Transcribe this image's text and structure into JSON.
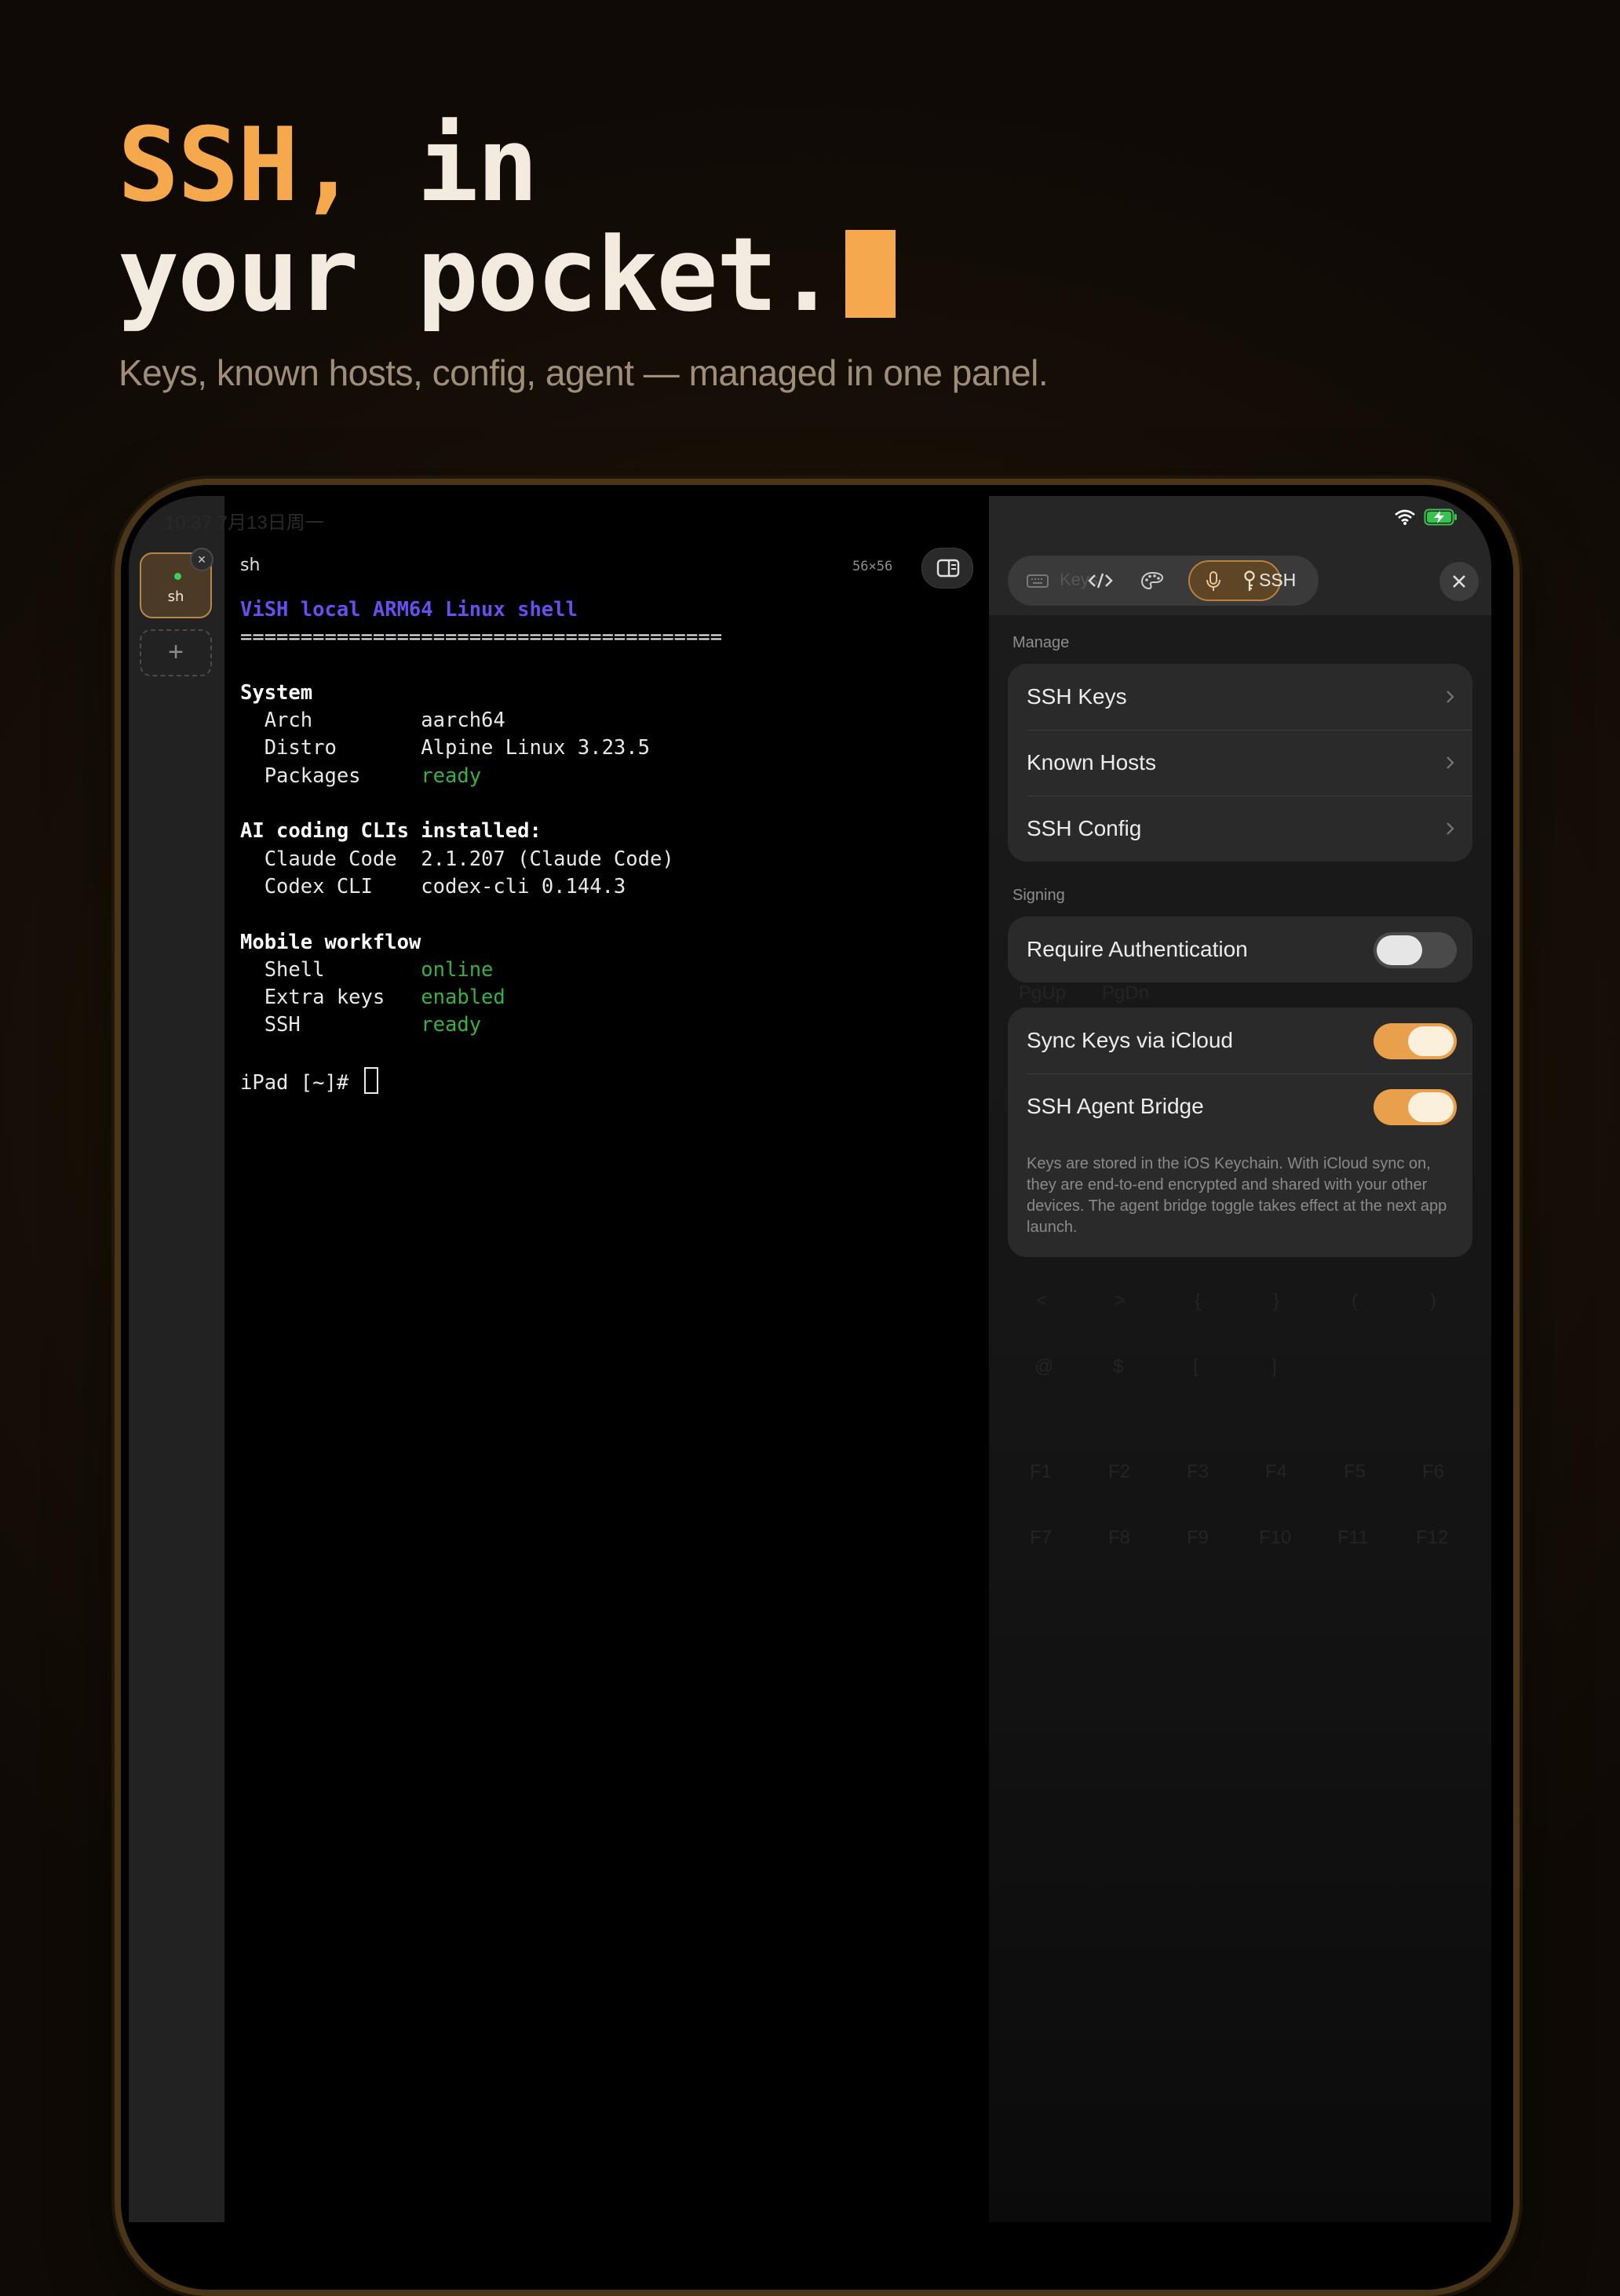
{
  "hero": {
    "line1_accent": "SSH,",
    "line1_rest": " in",
    "line2": "your pocket.",
    "subtitle": "Keys, known hosts, config, agent — managed in one panel."
  },
  "status_bar": {
    "time": "10:37  7月13日周一"
  },
  "sidebar": {
    "tab_label": "sh",
    "tab_close": "×",
    "add": "+"
  },
  "terminal": {
    "title": "sh",
    "size": "56×56",
    "heading": "ViSH local ARM64 Linux shell",
    "rule": "========================================",
    "system_title": "System",
    "arch_label": "  Arch         ",
    "arch_value": "aarch64",
    "distro_label": "  Distro       ",
    "distro_value": "Alpine Linux 3.23.5",
    "packages_label": "  Packages     ",
    "packages_value": "ready",
    "ai_title": "AI coding CLIs installed:",
    "claude_label": "  Claude Code  ",
    "claude_value": "2.1.207 (Claude Code)",
    "codex_label": "  Codex CLI    ",
    "codex_value": "codex-cli 0.144.3",
    "mobile_title": "Mobile workflow",
    "shell_label": "  Shell        ",
    "shell_value": "online",
    "extra_label": "  Extra keys   ",
    "extra_value": "enabled",
    "ssh_label": "  SSH          ",
    "ssh_value": "ready",
    "prompt": "iPad [~]# "
  },
  "panel": {
    "segments": {
      "ghost_label": "Keys",
      "selected_label": "SSH"
    },
    "manage_header": "Manage",
    "manage_items": [
      {
        "label": "SSH Keys"
      },
      {
        "label": "Known Hosts"
      },
      {
        "label": "SSH Config"
      }
    ],
    "signing_header": "Signing",
    "require_auth": {
      "label": "Require Authentication",
      "on": false
    },
    "sync_icloud": {
      "label": "Sync Keys via iCloud",
      "on": true
    },
    "agent_bridge": {
      "label": "SSH Agent Bridge",
      "on": true
    },
    "footnote": "Keys are stored in the iOS Keychain. With iCloud sync on, they are end-to-end encrypted and shared with your other devices. The agent bridge toggle takes effect at the next app launch."
  },
  "background_keys": {
    "pg": [
      "PgUp",
      "PgDn"
    ],
    "row1": [
      "<",
      ">",
      "{",
      "}",
      "(",
      ")"
    ],
    "row2": [
      "@",
      "$",
      "[",
      "]"
    ],
    "fn_row1": [
      "F1",
      "F2",
      "F3",
      "F4",
      "F5",
      "F6"
    ],
    "fn_row2": [
      "F7",
      "F8",
      "F9",
      "F10",
      "F11",
      "F12"
    ]
  },
  "colors": {
    "accent": "#f5a94c",
    "toggle_on": "#e9a04d",
    "term_heading": "#6550ee",
    "term_ok": "#38b043"
  }
}
